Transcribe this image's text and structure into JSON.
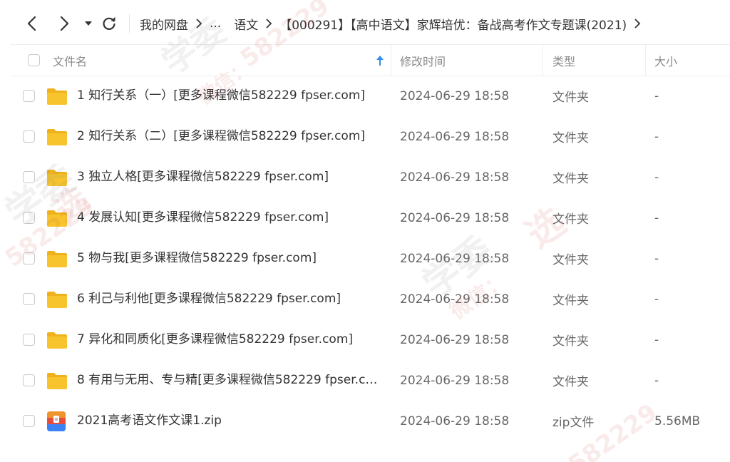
{
  "toolbar": {
    "icons": [
      "back-icon",
      "forward-icon",
      "dropdown-icon",
      "refresh-icon"
    ],
    "breadcrumb": [
      "我的网盘",
      "...",
      "语文",
      "【000291】【高中语文】家辉培优：备战高考作文专题课(2021)"
    ]
  },
  "header": {
    "name": "文件名",
    "modified": "修改时间",
    "type": "类型",
    "size": "大小",
    "sort_icon": "sort-ascending-arrow-icon"
  },
  "files": [
    {
      "name": "1 知行关系（一）[更多课程微信582229 fpser.com]",
      "modified": "2024-06-29 18:58",
      "type": "文件夹",
      "size": "-",
      "icon": "folder-icon"
    },
    {
      "name": "2 知行关系（二）[更多课程微信582229 fpser.com]",
      "modified": "2024-06-29 18:58",
      "type": "文件夹",
      "size": "-",
      "icon": "folder-icon"
    },
    {
      "name": "3 独立人格[更多课程微信582229 fpser.com]",
      "modified": "2024-06-29 18:58",
      "type": "文件夹",
      "size": "-",
      "icon": "folder-icon"
    },
    {
      "name": "4 发展认知[更多课程微信582229 fpser.com]",
      "modified": "2024-06-29 18:58",
      "type": "文件夹",
      "size": "-",
      "icon": "folder-icon"
    },
    {
      "name": "5 物与我[更多课程微信582229 fpser.com]",
      "modified": "2024-06-29 18:58",
      "type": "文件夹",
      "size": "-",
      "icon": "folder-icon"
    },
    {
      "name": "6 利己与利他[更多课程微信582229 fpser.com]",
      "modified": "2024-06-29 18:58",
      "type": "文件夹",
      "size": "-",
      "icon": "folder-icon"
    },
    {
      "name": "7 异化和同质化[更多课程微信582229 fpser.com]",
      "modified": "2024-06-29 18:58",
      "type": "文件夹",
      "size": "-",
      "icon": "folder-icon"
    },
    {
      "name": "8 有用与无用、专与精[更多课程微信582229 fpser.co...",
      "modified": "2024-06-29 18:58",
      "type": "文件夹",
      "size": "-",
      "icon": "folder-icon"
    },
    {
      "name": "2021高考语文作文课1.zip",
      "modified": "2024-06-29 18:58",
      "type": "zip文件",
      "size": "5.56MB",
      "icon": "zip-archive-icon"
    }
  ],
  "watermark": {
    "lines": [
      "学委",
      "微信：",
      "582229",
      "学委",
      "选",
      "582229",
      "微信：",
      "学委",
      "选",
      "582229"
    ]
  },
  "colors": {
    "folder": "#F7C42E",
    "folder_dark": "#EFB21C",
    "sort_arrow": "#2F8DF4",
    "watermark": "#D23C3C"
  }
}
